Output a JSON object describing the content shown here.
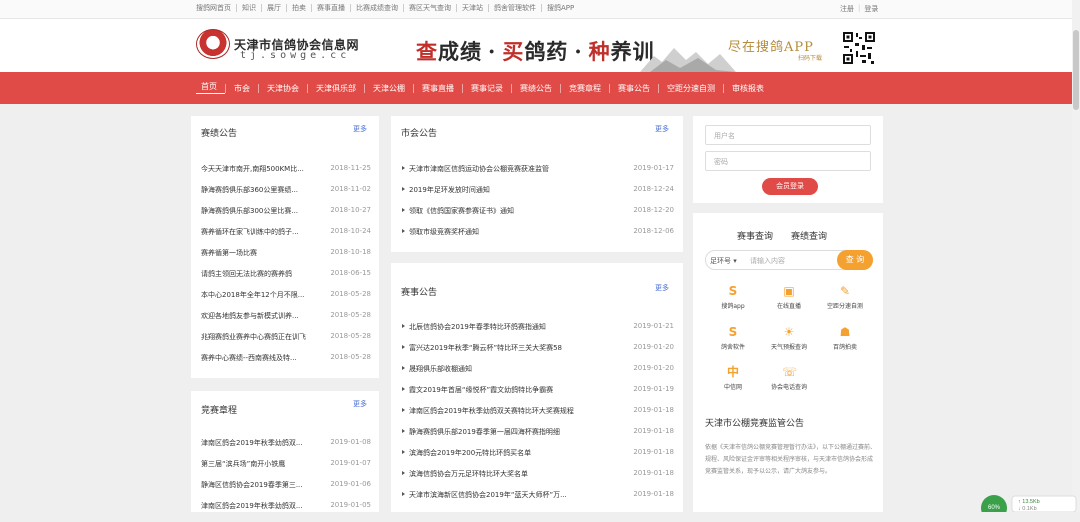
{
  "topbar": {
    "links": [
      "搜鸽网首页",
      "知识",
      "展厅",
      "拍卖",
      "赛事直播",
      "比赛成绩查询",
      "赛区天气查询",
      "天津站",
      "鸽舍管理软件",
      "搜鸽APP"
    ],
    "register": "注册",
    "login": "登录"
  },
  "header": {
    "site_title": "天津市信鸽协会信息网",
    "site_url": "tj.sowge.cc",
    "slogan_parts": [
      "查",
      "成绩",
      "·",
      "买",
      "鸽药",
      "·",
      "种",
      "养训"
    ],
    "app_text": "尽在搜鸽APP",
    "app_sub": "扫码下载"
  },
  "nav": {
    "items": [
      "首页",
      "市会",
      "天津协会",
      "天津俱乐部",
      "天津公棚",
      "赛事直播",
      "赛事记录",
      "赛绩公告",
      "竞赛章程",
      "赛事公告",
      "空距分速自测",
      "审核报表"
    ]
  },
  "saiji": {
    "title": "赛绩公告",
    "more": "更多",
    "items": [
      {
        "title": "今天天津市南开,南翔500KM比...",
        "date": "2018-11-25"
      },
      {
        "title": "静海赛鸽俱乐部360公里赛绩...",
        "date": "2018-11-02"
      },
      {
        "title": "静海赛鸽俱乐部300公里比赛...",
        "date": "2018-10-27"
      },
      {
        "title": "赛养循环在家飞训练中的鸽子...",
        "date": "2018-10-24"
      },
      {
        "title": "赛养循第一场比赛",
        "date": "2018-10-18"
      },
      {
        "title": "请鸽主领回无法比赛的赛养鸽",
        "date": "2018-06-15"
      },
      {
        "title": "本中心2018年全年12个月不限...",
        "date": "2018-05-28"
      },
      {
        "title": "欢迎各地鸽友参与新模式训养...",
        "date": "2018-05-28"
      },
      {
        "title": "兆翔赛鸽业赛养中心赛鸽正在训飞",
        "date": "2018-05-28"
      },
      {
        "title": "赛养中心赛绩--西南赛线及特...",
        "date": "2018-05-28"
      }
    ]
  },
  "jingsai": {
    "title": "竞赛章程",
    "more": "更多",
    "items": [
      {
        "title": "津南区鸽会2019年秋季幼鸽双...",
        "date": "2019-01-08"
      },
      {
        "title": "第三届“滨兵场”南开小铁鹰",
        "date": "2019-01-07"
      },
      {
        "title": "静海区信鸽协会2019春季第三...",
        "date": "2019-01-06"
      },
      {
        "title": "津南区鸽会2019年秋季幼鸽双...",
        "date": "2019-01-05"
      }
    ]
  },
  "shihui": {
    "title": "市会公告",
    "more": "更多",
    "items": [
      {
        "title": "天津市津南区信鸽运动协会公棚竞赛获准监管",
        "date": "2019-01-17"
      },
      {
        "title": "2019年足环发放时间通知",
        "date": "2018-12-24"
      },
      {
        "title": "领取《信鸽国家赛参赛证书》通知",
        "date": "2018-12-20"
      },
      {
        "title": "领取市级竞赛奖杯通知",
        "date": "2018-12-06"
      }
    ]
  },
  "saishi": {
    "title": "赛事公告",
    "more": "更多",
    "items": [
      {
        "title": "北辰信鸽协会2019年春季特比环鸽赛指通知",
        "date": "2019-01-21"
      },
      {
        "title": "富兴达2019年秋季“腾云杯”特比环三关大奖赛58",
        "date": "2019-01-20"
      },
      {
        "title": "晟翔俱乐部收棚通知",
        "date": "2019-01-20"
      },
      {
        "title": "霞文2019年首届“缘悦杯”霞文幼鸽特比争霸赛",
        "date": "2019-01-19"
      },
      {
        "title": "津南区鸽会2019年秋季幼鸽双关赛特比环大奖赛规程",
        "date": "2019-01-18"
      },
      {
        "title": "静海赛鸽俱乐部2019春季第一届四海杯赛指明细",
        "date": "2019-01-18"
      },
      {
        "title": "滨海鸽会2019年200元特比环鸽买名单",
        "date": "2019-01-18"
      },
      {
        "title": "滨海信鸽协会万元足环特比环大奖名单",
        "date": "2019-01-18"
      },
      {
        "title": "天津市滨海新区信鸽协会2019年“蓝天大师杯”万...",
        "date": "2019-01-18"
      }
    ]
  },
  "login": {
    "username_placeholder": "用户名",
    "password_placeholder": "密码",
    "button": "会员登录"
  },
  "query": {
    "tabs": [
      "赛事查询",
      "赛绩查询"
    ],
    "select": "足环号",
    "placeholder": "请输入内容",
    "button": "查 询",
    "grid": [
      {
        "icon": "S",
        "label": "搜鸽app"
      },
      {
        "icon": "▣",
        "label": "在线直播"
      },
      {
        "icon": "✎",
        "label": "空距分速自测"
      },
      {
        "icon": "S",
        "label": "鸽舍软件"
      },
      {
        "icon": "☀",
        "label": "天气预报查询"
      },
      {
        "icon": "☗",
        "label": "百鸽拍卖"
      },
      {
        "icon": "中",
        "label": "中信网"
      },
      {
        "icon": "☏",
        "label": "协会电话查询"
      }
    ],
    "notice_title": "天津市公棚竞赛监管公告",
    "notice_text": "依据《天津市信鸽公棚竞赛管理暂行办法》，以下公棚通过赛前、规程、风险保证金评审等相关程序审核，与天津市信鸽协会形成竞赛监管关系，现予以公示，请广大鸽友参与。"
  },
  "widget": {
    "percent": "60%",
    "speed": "13.5Kb",
    "sub": "0.1Kb"
  }
}
